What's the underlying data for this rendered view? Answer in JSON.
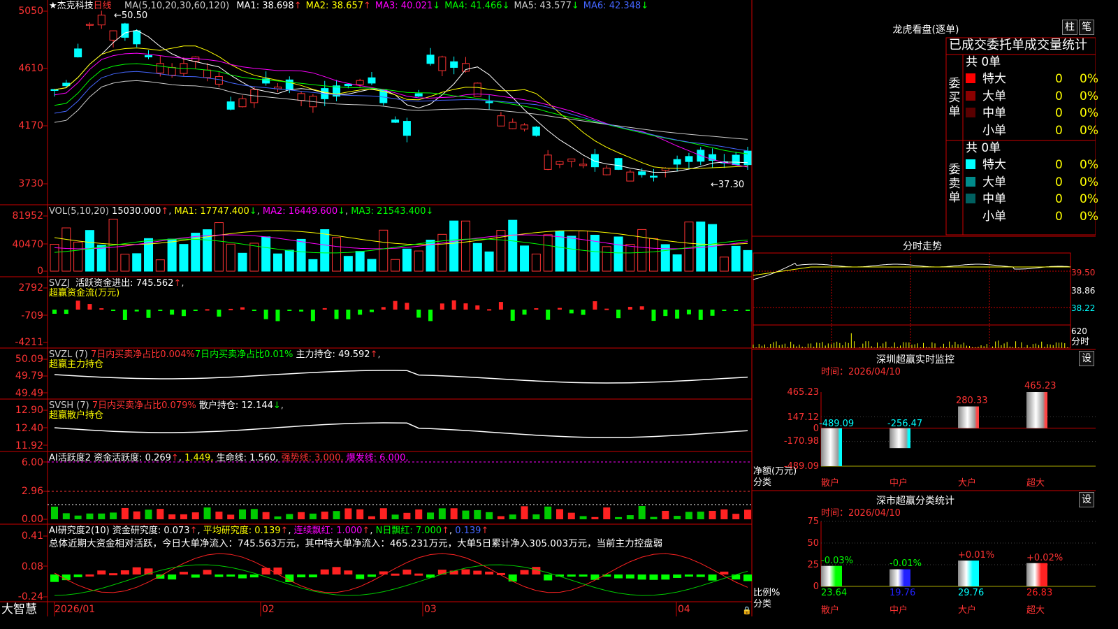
{
  "header": {
    "stock_name": "★杰克科技",
    "period": "日线",
    "ma_label": "MA(5,10,20,30,60,120)",
    "ma": [
      {
        "name": "MA1:",
        "value": "38.698",
        "arrow": "↑",
        "color": "#ffffff"
      },
      {
        "name": "MA2:",
        "value": "38.657",
        "arrow": "↑",
        "color": "#ffff00"
      },
      {
        "name": "MA3:",
        "value": "40.021",
        "arrow": "↓",
        "color": "#ff00ff"
      },
      {
        "name": "MA4:",
        "value": "41.466",
        "arrow": "↓",
        "color": "#00ff00"
      },
      {
        "name": "MA5:",
        "value": "43.577",
        "arrow": "↓",
        "color": "#cccccc"
      },
      {
        "name": "MA6:",
        "value": "42.348",
        "arrow": "↓",
        "color": "#4466ff"
      }
    ],
    "high_label": "50.50",
    "low_label": "37.30"
  },
  "price_axis": [
    "5050",
    "4610",
    "4170",
    "3730"
  ],
  "vol": {
    "title": "VOL(5,10,20)",
    "value": "15030.000",
    "arrow": "↑",
    "ma1": "MA1: 17747.400",
    "ma2": "MA2: 16449.600",
    "ma3": "MA3: 21543.400",
    "axis": [
      "81952",
      "40470",
      "0"
    ]
  },
  "svzj": {
    "title": "SVZJ",
    "label": "活跃资金进出:",
    "value": "745.562",
    "arrow": "↑",
    "sub": "超赢资金流(万元)",
    "axis": [
      "2792",
      "-709",
      "-4211"
    ]
  },
  "svzl": {
    "title": "SVZL (7)",
    "t1": "7日内买卖净占比0.004%",
    "t2": "7日内买卖净占比0.01%",
    "t3": "主力持仓:",
    "v3": "49.592",
    "sub": "超赢主力持仓",
    "axis": [
      "50.09",
      "49.79",
      "49.49"
    ]
  },
  "svsh": {
    "title": "SVSH (7)",
    "t1": "7日内买卖净占比0.079%",
    "t2": "散户持仓:",
    "v2": "12.144",
    "sub": "超赢散户持仓",
    "axis": [
      "12.90",
      "12.40",
      "11.92"
    ]
  },
  "ai1": {
    "title": "AI活跃度2",
    "t1": "资金活跃度:",
    "v1": "0.269",
    "v2": "1.449,",
    "t3": "生命线:",
    "v3": "1.560,",
    "t4": "强势线:",
    "v4": "3.000,",
    "t5": "爆发线:",
    "v5": "6.000,",
    "axis": [
      "6.00",
      "2.96",
      "0.00"
    ]
  },
  "ai2": {
    "title": "AI研究度2(10)",
    "t1": "资金研究度:",
    "v1": "0.073",
    "t2": "平均研究度:",
    "v2": "0.139",
    "t3": "连续飘红:",
    "v3": "1.000",
    "t4": "N日飘红:",
    "v4": "7.000",
    "v5": "0.139",
    "summary": "总体近期大资金相对活跃，今日大单净流入：745.563万元，其中特大单净流入：465.231万元，大单5日累计净入305.003万元，当前主力控盘弱",
    "axis": [
      "0.41",
      "0.08",
      "-0.24"
    ]
  },
  "date_axis": [
    "2026/01",
    "02",
    "03",
    "04"
  ],
  "logo": "大智慧",
  "right": {
    "lhb_title": "龙虎看盘(逐单)",
    "btn1": "柱",
    "btn2": "笔",
    "stats_title": "已成交委托单成交量统计",
    "buy": {
      "total": "共 0单",
      "side": [
        "委",
        "买",
        "单"
      ],
      "rows": [
        {
          "label": "特大",
          "v": "0",
          "p": "0%",
          "color": "#ff0000"
        },
        {
          "label": "大单",
          "v": "0",
          "p": "0%",
          "color": "#8b0000"
        },
        {
          "label": "中单",
          "v": "0",
          "p": "0%",
          "color": "#5a0000"
        },
        {
          "label": "小单",
          "v": "0",
          "p": "0%",
          "color": ""
        }
      ]
    },
    "sell": {
      "total": "共 0单",
      "side": [
        "委",
        "卖",
        "单"
      ],
      "rows": [
        {
          "label": "特大",
          "v": "0",
          "p": "0%",
          "color": "#00ffff"
        },
        {
          "label": "大单",
          "v": "0",
          "p": "0%",
          "color": "#008b8b"
        },
        {
          "label": "中单",
          "v": "0",
          "p": "0%",
          "color": "#006060"
        },
        {
          "label": "小单",
          "v": "0",
          "p": "0%",
          "color": ""
        }
      ]
    },
    "intraday_title": "分时走势",
    "intraday_axis": [
      "39.50",
      "38.86",
      "38.22"
    ],
    "intraday_vol": [
      "620",
      "分时"
    ],
    "sz_title": "深圳超赢实时监控",
    "sz_set": "设",
    "sz_time": "时间：2026/04/10",
    "sz_axis": [
      "465.23",
      "147.12",
      "0",
      "-170.98",
      "-489.09"
    ],
    "sz_ylabel": "净额(万元)",
    "sz_xlabel": "分类",
    "sz_bars": [
      {
        "name": "散户",
        "value": -489.09,
        "label": "-489.09"
      },
      {
        "name": "中户",
        "value": -256.47,
        "label": "-256.47"
      },
      {
        "name": "大户",
        "value": 280.33,
        "label": "280.33"
      },
      {
        "name": "超大",
        "value": 465.23,
        "label": "465.23"
      }
    ],
    "cls_title": "深市超赢分类统计",
    "cls_set": "设",
    "cls_time": "时间：2026/04/10",
    "cls_axis": [
      "75",
      "50",
      "25",
      "0"
    ],
    "cls_ylabel": "比例%",
    "cls_xlabel": "分类",
    "cls_bars": [
      {
        "name": "散户",
        "value": 23.64,
        "label": "23.64",
        "delta": "-0.03%",
        "color": "#00ff00"
      },
      {
        "name": "中户",
        "value": 19.76,
        "label": "19.76",
        "delta": "-0.01%",
        "color": "#2222ff"
      },
      {
        "name": "大户",
        "value": 29.76,
        "label": "29.76",
        "delta": "+0.01%",
        "color": "#00ffff"
      },
      {
        "name": "超大",
        "value": 26.83,
        "label": "26.83",
        "delta": "+0.02%",
        "color": "#ff2222"
      }
    ]
  },
  "colors": {
    "up": "#ff3333",
    "down": "#00ffff",
    "grid": "#cc0000"
  }
}
